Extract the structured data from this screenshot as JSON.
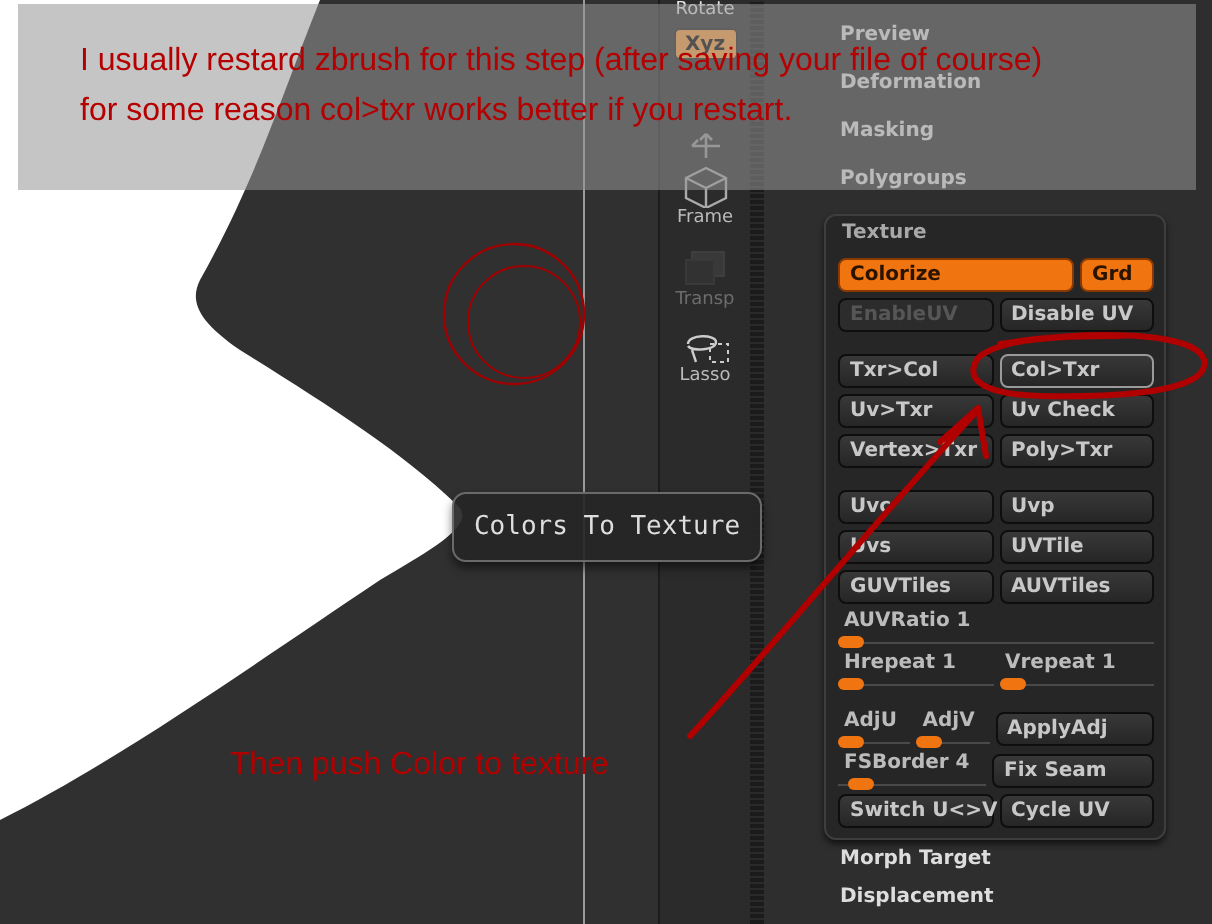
{
  "note": {
    "lines": [
      "I usually restard zbrush for this step (after saving your file of course)",
      "for some reason col>txr works better if you restart."
    ]
  },
  "canvas": {
    "tooltip": "Colors To Texture",
    "annotation": "Then push Color to texture"
  },
  "shelf": [
    {
      "kind": "rotate",
      "label": "Rotate",
      "on": false,
      "disabled": false
    },
    {
      "kind": "xyz",
      "label": "Xyz",
      "on": true,
      "disabled": false
    },
    {
      "kind": "move",
      "on": false,
      "disabled": false
    },
    {
      "kind": "frame",
      "label": "Frame",
      "on": false,
      "disabled": false
    },
    {
      "kind": "transp",
      "label": "Transp",
      "on": false,
      "disabled": true
    },
    {
      "kind": "lasso",
      "label": "Lasso",
      "on": false,
      "disabled": false
    }
  ],
  "menus_top": [
    "Preview",
    "Deformation",
    "Masking",
    "Polygroups"
  ],
  "texture": {
    "title": "Texture",
    "groups": [
      [
        [
          {
            "kind": "button",
            "label": "Colorize",
            "on": true,
            "disabled": false,
            "highlighted": false
          },
          {
            "kind": "small-button",
            "label": "Grd",
            "on": true,
            "disabled": false,
            "highlighted": false
          }
        ],
        [
          {
            "kind": "button",
            "label": "EnableUV",
            "on": false,
            "disabled": true,
            "highlighted": false
          },
          {
            "kind": "button",
            "label": "Disable UV",
            "on": false,
            "disabled": false,
            "highlighted": false
          }
        ]
      ],
      [
        [
          {
            "kind": "button",
            "label": "Txr>Col",
            "on": false,
            "disabled": false,
            "highlighted": false
          },
          {
            "kind": "button",
            "label": "Col>Txr",
            "on": false,
            "disabled": false,
            "highlighted": true
          }
        ],
        [
          {
            "kind": "button",
            "label": "Uv>Txr",
            "on": false,
            "disabled": false,
            "highlighted": false
          },
          {
            "kind": "button",
            "label": "Uv Check",
            "on": false,
            "disabled": false,
            "highlighted": false
          }
        ],
        [
          {
            "kind": "button",
            "label": "Vertex>Txr",
            "on": false,
            "disabled": false,
            "highlighted": false
          },
          {
            "kind": "button",
            "label": "Poly>Txr",
            "on": false,
            "disabled": false,
            "highlighted": false
          }
        ]
      ],
      [
        [
          {
            "kind": "button",
            "label": "Uvc",
            "on": false,
            "disabled": false,
            "highlighted": false
          },
          {
            "kind": "button",
            "label": "Uvp",
            "on": false,
            "disabled": false,
            "highlighted": false
          }
        ],
        [
          {
            "kind": "button",
            "label": "Uvs",
            "on": false,
            "disabled": false,
            "highlighted": false
          },
          {
            "kind": "button",
            "label": "UVTile",
            "on": false,
            "disabled": false,
            "highlighted": false
          }
        ],
        [
          {
            "kind": "button",
            "label": "GUVTiles",
            "on": false,
            "disabled": false,
            "highlighted": false
          },
          {
            "kind": "button",
            "label": "AUVTiles",
            "on": false,
            "disabled": false,
            "highlighted": false
          }
        ],
        [
          {
            "kind": "slider",
            "label": "AUVRatio 1",
            "level": 0
          }
        ],
        [
          {
            "kind": "slider",
            "label": "Hrepeat 1",
            "level": 0
          },
          {
            "kind": "slider",
            "label": "Vrepeat 1",
            "level": 0
          }
        ]
      ],
      [
        [
          {
            "kind": "mini-slider",
            "label": "AdjU",
            "level": 0
          },
          {
            "kind": "mini-slider",
            "label": "AdjV",
            "level": 0
          },
          {
            "kind": "button",
            "label": "ApplyAdj",
            "on": false,
            "disabled": false,
            "highlighted": false
          }
        ],
        [
          {
            "kind": "slider",
            "label": "FSBorder 4",
            "level": 0.08
          },
          {
            "kind": "button",
            "label": "Fix Seam",
            "on": false,
            "disabled": false,
            "highlighted": false
          }
        ],
        [
          {
            "kind": "button",
            "label": "Switch U<>V",
            "on": false,
            "disabled": false,
            "highlighted": false
          },
          {
            "kind": "button",
            "label": "Cycle UV",
            "on": false,
            "disabled": false,
            "highlighted": false
          }
        ]
      ]
    ]
  },
  "menus_bottom": [
    "Morph Target",
    "Displacement"
  ]
}
